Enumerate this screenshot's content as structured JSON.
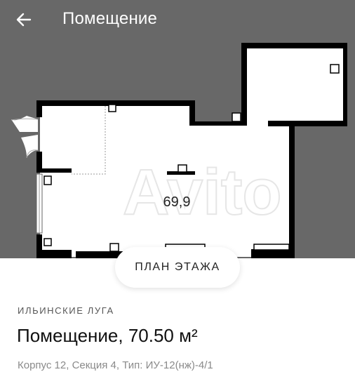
{
  "appbar": {
    "title": "Помещение",
    "back_icon": "arrow-left-icon"
  },
  "floor_plan": {
    "area_label": "69,9",
    "watermark": "Avito",
    "colors": {
      "background": "#686868",
      "room_fill": "#ffffff",
      "walls": "#000000"
    }
  },
  "plan_button": {
    "label": "ПЛАН ЭТАЖА"
  },
  "listing": {
    "complex_name": "ИЛЬИНСКИЕ ЛУГА",
    "title": "Помещение, 70.50 м²",
    "details": "Корпус 12, Секция 4, Тип: ИУ-12(нж)-4/1"
  }
}
